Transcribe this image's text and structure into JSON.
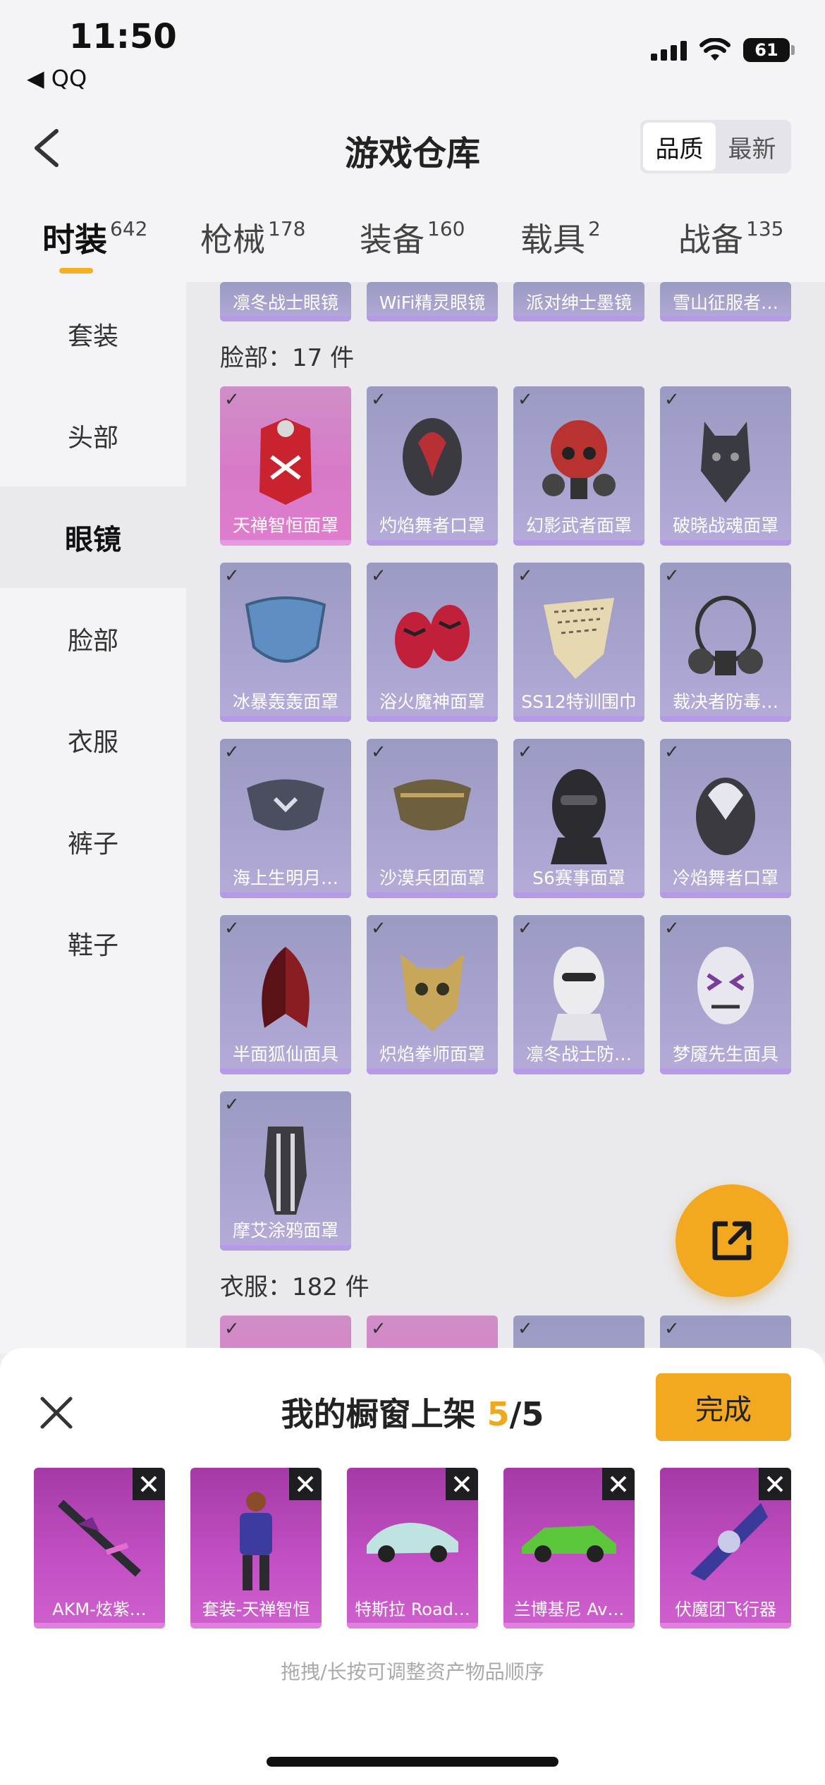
{
  "status_bar": {
    "time": "11:50",
    "back_app": "◀ QQ",
    "battery": "61"
  },
  "header": {
    "title": "游戏仓库",
    "sort_options": [
      "品质",
      "最新"
    ]
  },
  "tabs": [
    {
      "label": "时装",
      "count": "642"
    },
    {
      "label": "枪械",
      "count": "178"
    },
    {
      "label": "装备",
      "count": "160"
    },
    {
      "label": "载具",
      "count": "2"
    },
    {
      "label": "战备",
      "count": "135"
    }
  ],
  "sidebar": [
    "套装",
    "头部",
    "眼镜",
    "脸部",
    "衣服",
    "裤子",
    "鞋子"
  ],
  "glasses_row": [
    "凛冬战士眼镜",
    "WiFi精灵眼镜",
    "派对绅士墨镜",
    "雪山征服者…"
  ],
  "face_section": {
    "title": "脸部：17 件",
    "items": [
      "天禅智恒面罩",
      "灼焰舞者口罩",
      "幻影武者面罩",
      "破晓战魂面罩",
      "冰暴轰轰面罩",
      "浴火魔神面罩",
      "SS12特训围巾",
      "裁决者防毒…",
      "海上生明月…",
      "沙漠兵团面罩",
      "S6赛事面罩",
      "冷焰舞者口罩",
      "半面狐仙面具",
      "炽焰拳师面罩",
      "凛冬战士防…",
      "梦魇先生面具",
      "摩艾涂鸦面罩"
    ]
  },
  "clothes_section": {
    "title": "衣服：182 件"
  },
  "sheet": {
    "title_prefix": "我的橱窗上架",
    "count": "5",
    "total": "/5",
    "done_label": "完成",
    "items": [
      "AKM-炫紫…",
      "套装-天禅智恒",
      "特斯拉 Road…",
      "兰博基尼 Av…",
      "伏魔团飞行器"
    ],
    "hint": "拖拽/长按可调整资产物品顺序"
  },
  "colors": {
    "accent": "#f2a91f",
    "rare_purple": "#a8a4cf",
    "legendary_pink": "#d779c8",
    "showcase_purple": "#c14fc2"
  }
}
